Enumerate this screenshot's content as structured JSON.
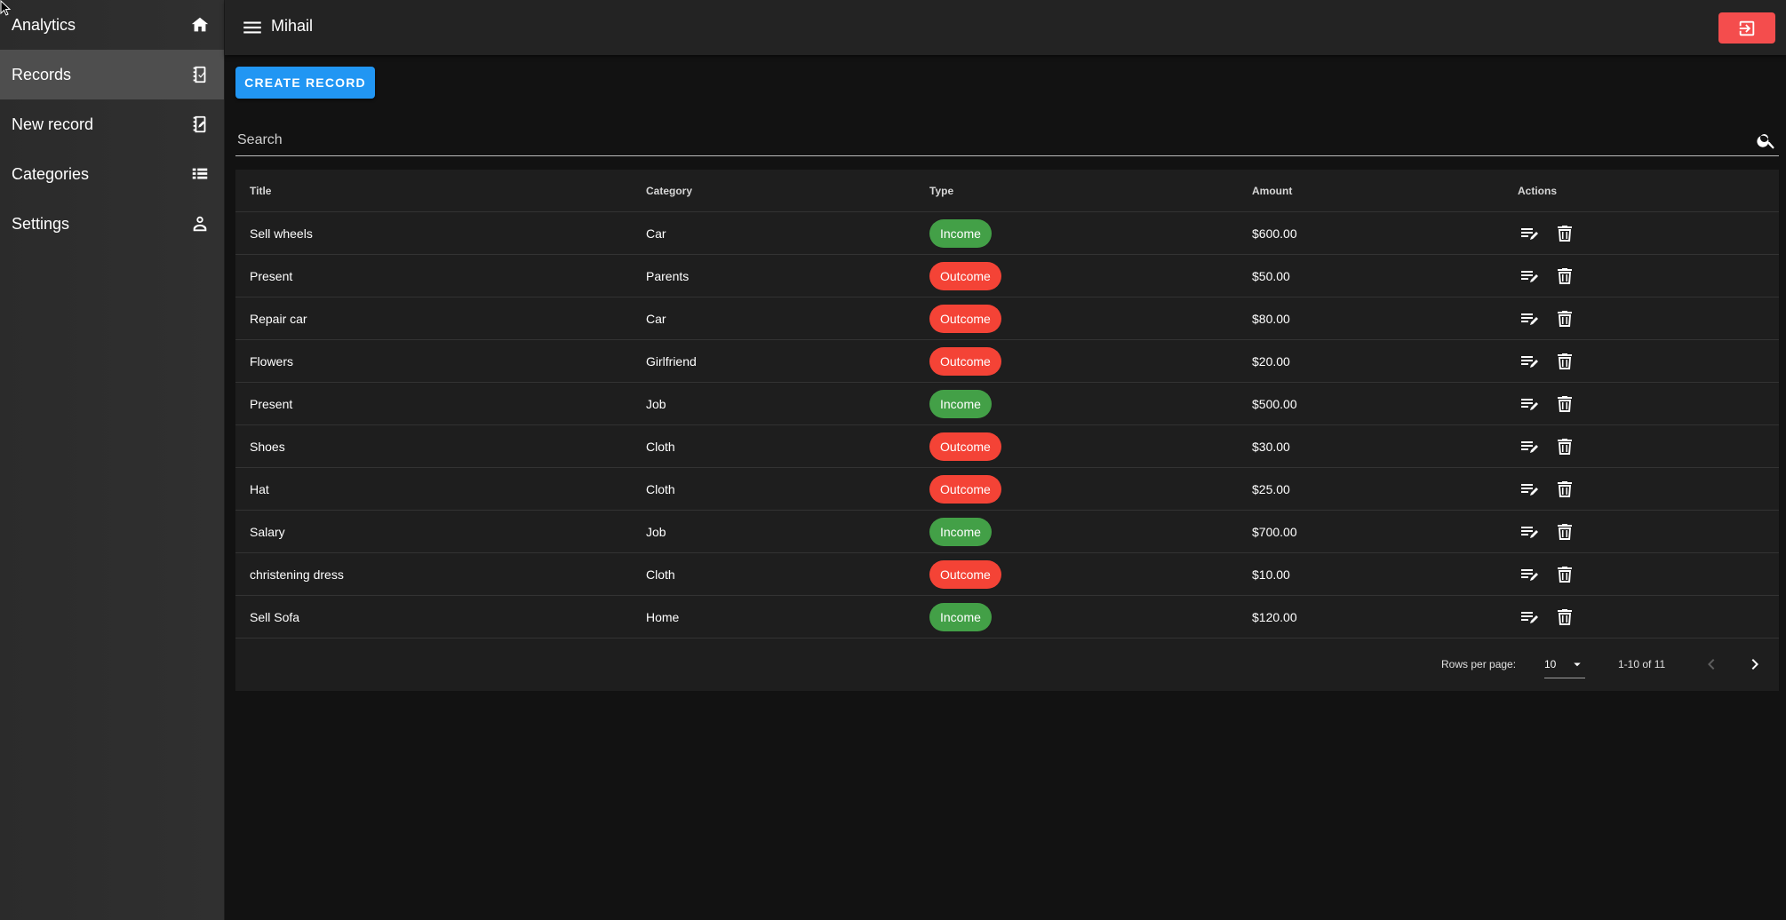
{
  "sidebar": {
    "items": [
      {
        "label": "Analytics",
        "icon": "home-icon",
        "active": false
      },
      {
        "label": "Records",
        "icon": "records-icon",
        "active": true
      },
      {
        "label": "New record",
        "icon": "new-record-icon",
        "active": false
      },
      {
        "label": "Categories",
        "icon": "list-icon",
        "active": false
      },
      {
        "label": "Settings",
        "icon": "settings-icon",
        "active": false
      }
    ]
  },
  "header": {
    "user_name": "Mihail",
    "logout_icon": "logout-icon"
  },
  "toolbar": {
    "create_label": "CREATE RECORD"
  },
  "search": {
    "placeholder": "Search",
    "value": ""
  },
  "table": {
    "columns": {
      "title": "Title",
      "category": "Category",
      "type": "Type",
      "amount": "Amount",
      "actions": "Actions"
    },
    "rows": [
      {
        "title": "Sell wheels",
        "category": "Car",
        "type": "Income",
        "amount": "$600.00"
      },
      {
        "title": "Present",
        "category": "Parents",
        "type": "Outcome",
        "amount": "$50.00"
      },
      {
        "title": "Repair car",
        "category": "Car",
        "type": "Outcome",
        "amount": "$80.00"
      },
      {
        "title": "Flowers",
        "category": "Girlfriend",
        "type": "Outcome",
        "amount": "$20.00"
      },
      {
        "title": "Present",
        "category": "Job",
        "type": "Income",
        "amount": "$500.00"
      },
      {
        "title": "Shoes",
        "category": "Cloth",
        "type": "Outcome",
        "amount": "$30.00"
      },
      {
        "title": "Hat",
        "category": "Cloth",
        "type": "Outcome",
        "amount": "$25.00"
      },
      {
        "title": "Salary",
        "category": "Job",
        "type": "Income",
        "amount": "$700.00"
      },
      {
        "title": "christening dress",
        "category": "Cloth",
        "type": "Outcome",
        "amount": "$10.00"
      },
      {
        "title": "Sell Sofa",
        "category": "Home",
        "type": "Income",
        "amount": "$120.00"
      }
    ]
  },
  "pagination": {
    "rows_per_page_label": "Rows per page:",
    "rows_per_page_value": "10",
    "range": "1-10 of 11"
  },
  "colors": {
    "income": "#43a047",
    "outcome": "#f44336",
    "accent": "#2196f3",
    "logout": "#f44d4d"
  }
}
